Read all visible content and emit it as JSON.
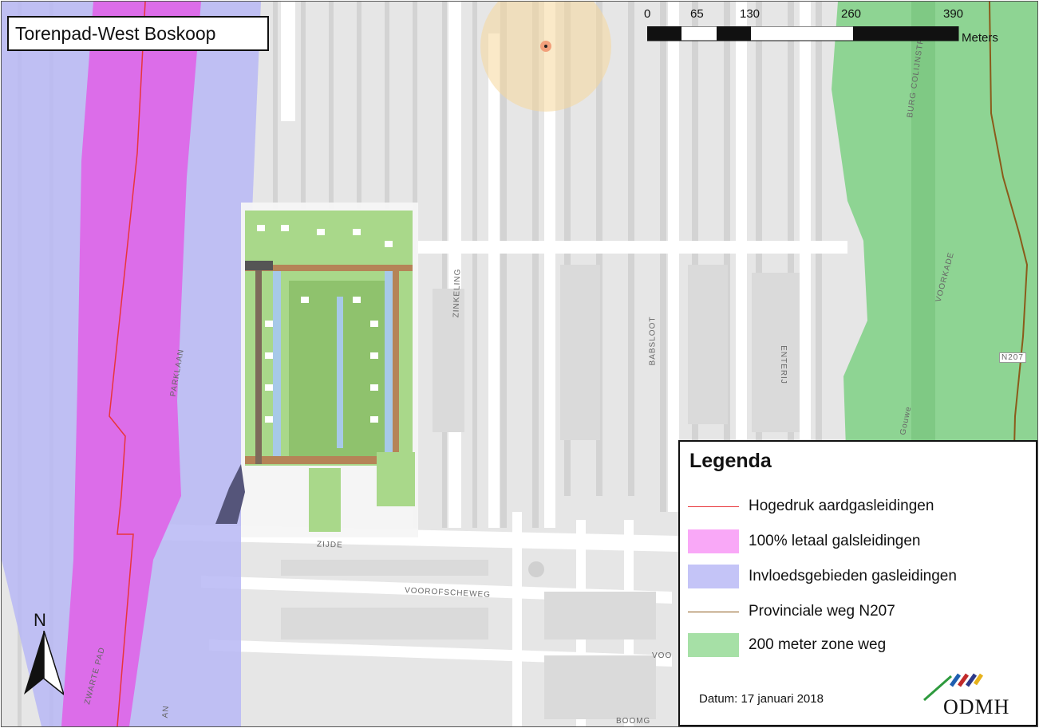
{
  "map": {
    "title": "Torenpad-West Boskoop",
    "scale_bar": {
      "ticks": [
        "0",
        "65",
        "130",
        "260",
        "390"
      ],
      "unit": "Meters"
    },
    "street_labels": {
      "parklaan": "PARKLAAN",
      "zinkeling": "ZINKELING",
      "babsloot": "BABSLOOT",
      "enterij": "ENTERIJ",
      "zijde": "ZIJDE",
      "voorofscheweg": "VOOROFSCHEWEG",
      "zwarte_pad": "ZWARTE PAD",
      "voorkade": "VOORKADE",
      "burg_colijnstr": "BURG COLIJNSTR",
      "goudwe": "Gouwe",
      "n207": "N207",
      "voo": "VOO",
      "an": "AN",
      "boom": "BOOMG"
    },
    "north_arrow_label": "N"
  },
  "legend": {
    "title": "Legenda",
    "items": [
      {
        "label": "Hogedruk aardgasleidingen",
        "symbol": "line",
        "color": "#e8353a"
      },
      {
        "label": "100% letaal galsleidingen",
        "symbol": "fill",
        "color": "#f9a8f7"
      },
      {
        "label": "Invloedsgebieden gasleidingen",
        "symbol": "fill",
        "color": "#c4c4f7"
      },
      {
        "label": "Provinciale weg N207",
        "symbol": "line",
        "color": "#8b5a1a"
      },
      {
        "label": "200 meter zone weg",
        "symbol": "fill",
        "color": "#a6e0a6"
      }
    ],
    "datum": "Datum: 17 januari 2018",
    "logo_text": "ODMH"
  },
  "colors": {
    "background": "#e9e9e9",
    "road": "#ffffff",
    "canal": "#d2d2d2",
    "influence_zone": "#b9b9f2",
    "lethal_zone": "#e05ee6",
    "green_zone": "#84d28a",
    "gas_pipe": "#e8353a",
    "plan_area": "#f4f4f4"
  }
}
